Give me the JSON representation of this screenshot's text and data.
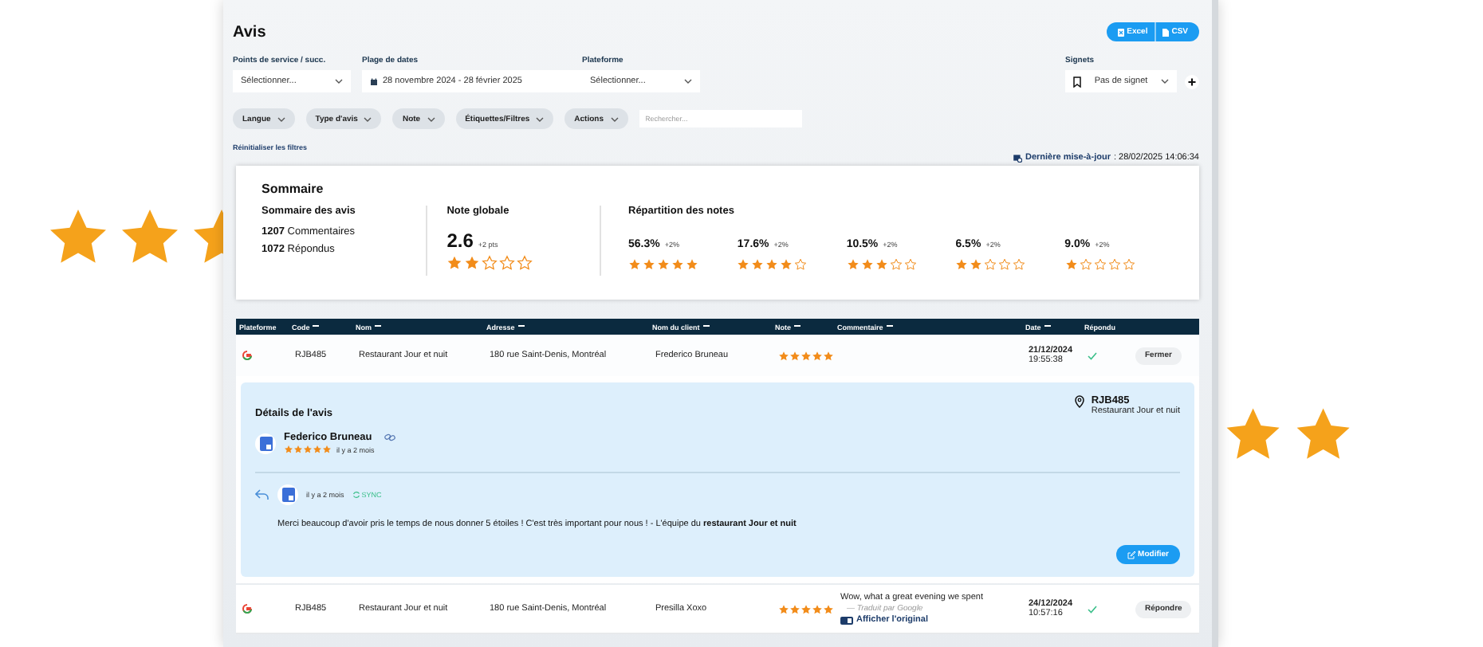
{
  "title": "Avis",
  "export_buttons": [
    {
      "kind": "excel",
      "label": "Excel"
    },
    {
      "kind": "csv",
      "label": "CSV"
    }
  ],
  "filters": [
    {
      "kind": "select",
      "label": "Points de service / succ.",
      "value": "Sélectionner..."
    },
    {
      "kind": "date",
      "label": "Plage de dates",
      "value": "28 novembre 2024 - 28 février 2025"
    },
    {
      "kind": "select",
      "label": "Plateforme",
      "value": "Sélectionner..."
    }
  ],
  "bookmarks": {
    "label": "Signets",
    "value": "Pas de signet"
  },
  "chips": [
    "Langue",
    "Type d'avis",
    "Note",
    "Étiquettes/Filtres",
    "Actions"
  ],
  "search": {
    "placeholder": "Rechercher..."
  },
  "reset_link": "Réinitialiser les filtres",
  "last_update": {
    "label": "Dernière mise-à-jour",
    "value": ": 28/02/2025 14:06:34"
  },
  "summary": {
    "title": "Sommaire",
    "reviews": {
      "title": "Sommaire des avis",
      "lines": [
        {
          "count": "1207",
          "label": "Commentaires"
        },
        {
          "count": "1072",
          "label": "Répondus"
        }
      ]
    },
    "overall": {
      "title": "Note globale",
      "score": "2.6",
      "delta": "+2 pts",
      "stars": 2
    },
    "distribution": {
      "title": "Répartition des notes",
      "items": [
        {
          "percent": "56.3%",
          "delta": "+2%",
          "stars": 5
        },
        {
          "percent": "17.6%",
          "delta": "+2%",
          "stars": 4
        },
        {
          "percent": "10.5%",
          "delta": "+2%",
          "stars": 3
        },
        {
          "percent": "6.5%",
          "delta": "+2%",
          "stars": 2
        },
        {
          "percent": "9.0%",
          "delta": "+2%",
          "stars": 1
        }
      ]
    }
  },
  "table": {
    "columns": [
      {
        "label": "Plateforme",
        "sortable": false
      },
      {
        "label": "Code",
        "sortable": true
      },
      {
        "label": "Nom",
        "sortable": true
      },
      {
        "label": "Adresse",
        "sortable": true
      },
      {
        "label": "Nom du client",
        "sortable": true
      },
      {
        "label": "Note",
        "sortable": true
      },
      {
        "label": "Commentaire",
        "sortable": true
      },
      {
        "label": "Date",
        "sortable": true
      },
      {
        "label": "Répondu",
        "sortable": false
      }
    ],
    "rows": [
      {
        "code": "RJB485",
        "name": "Restaurant Jour et nuit",
        "address": "180 rue Saint-Denis, Montréal",
        "client": "Frederico Bruneau",
        "stars": 5,
        "date": "21/12/2024",
        "time": "19:55:38",
        "answered": true,
        "action": "Fermer",
        "expanded": true,
        "details": {
          "title": "Détails de l'avis",
          "reviewer": "Federico Bruneau",
          "stars": 5,
          "age": "il y a 2 mois",
          "location_code": "RJB485",
          "location_name": "Restaurant Jour et nuit",
          "reply": {
            "age": "il y a 2 mois",
            "sync": "SYNC",
            "text": "Merci beaucoup d'avoir pris le temps de nous donner 5 étoiles ! C'est très important pour nous ! - L'équipe du **restaurant Jour et nuit**",
            "button": "Modifier"
          }
        }
      },
      {
        "code": "RJB485",
        "name": "Restaurant Jour et nuit",
        "address": "180 rue Saint-Denis, Montréal",
        "client": "Presilla Xoxo",
        "stars": 5,
        "comment": "Wow, what a great evening we spent",
        "translation": "— Traduit par Google",
        "original_link": "Afficher l'original",
        "date": "24/12/2024",
        "time": "10:57:16",
        "answered": true,
        "action": "Répondre",
        "expanded": false
      }
    ]
  }
}
